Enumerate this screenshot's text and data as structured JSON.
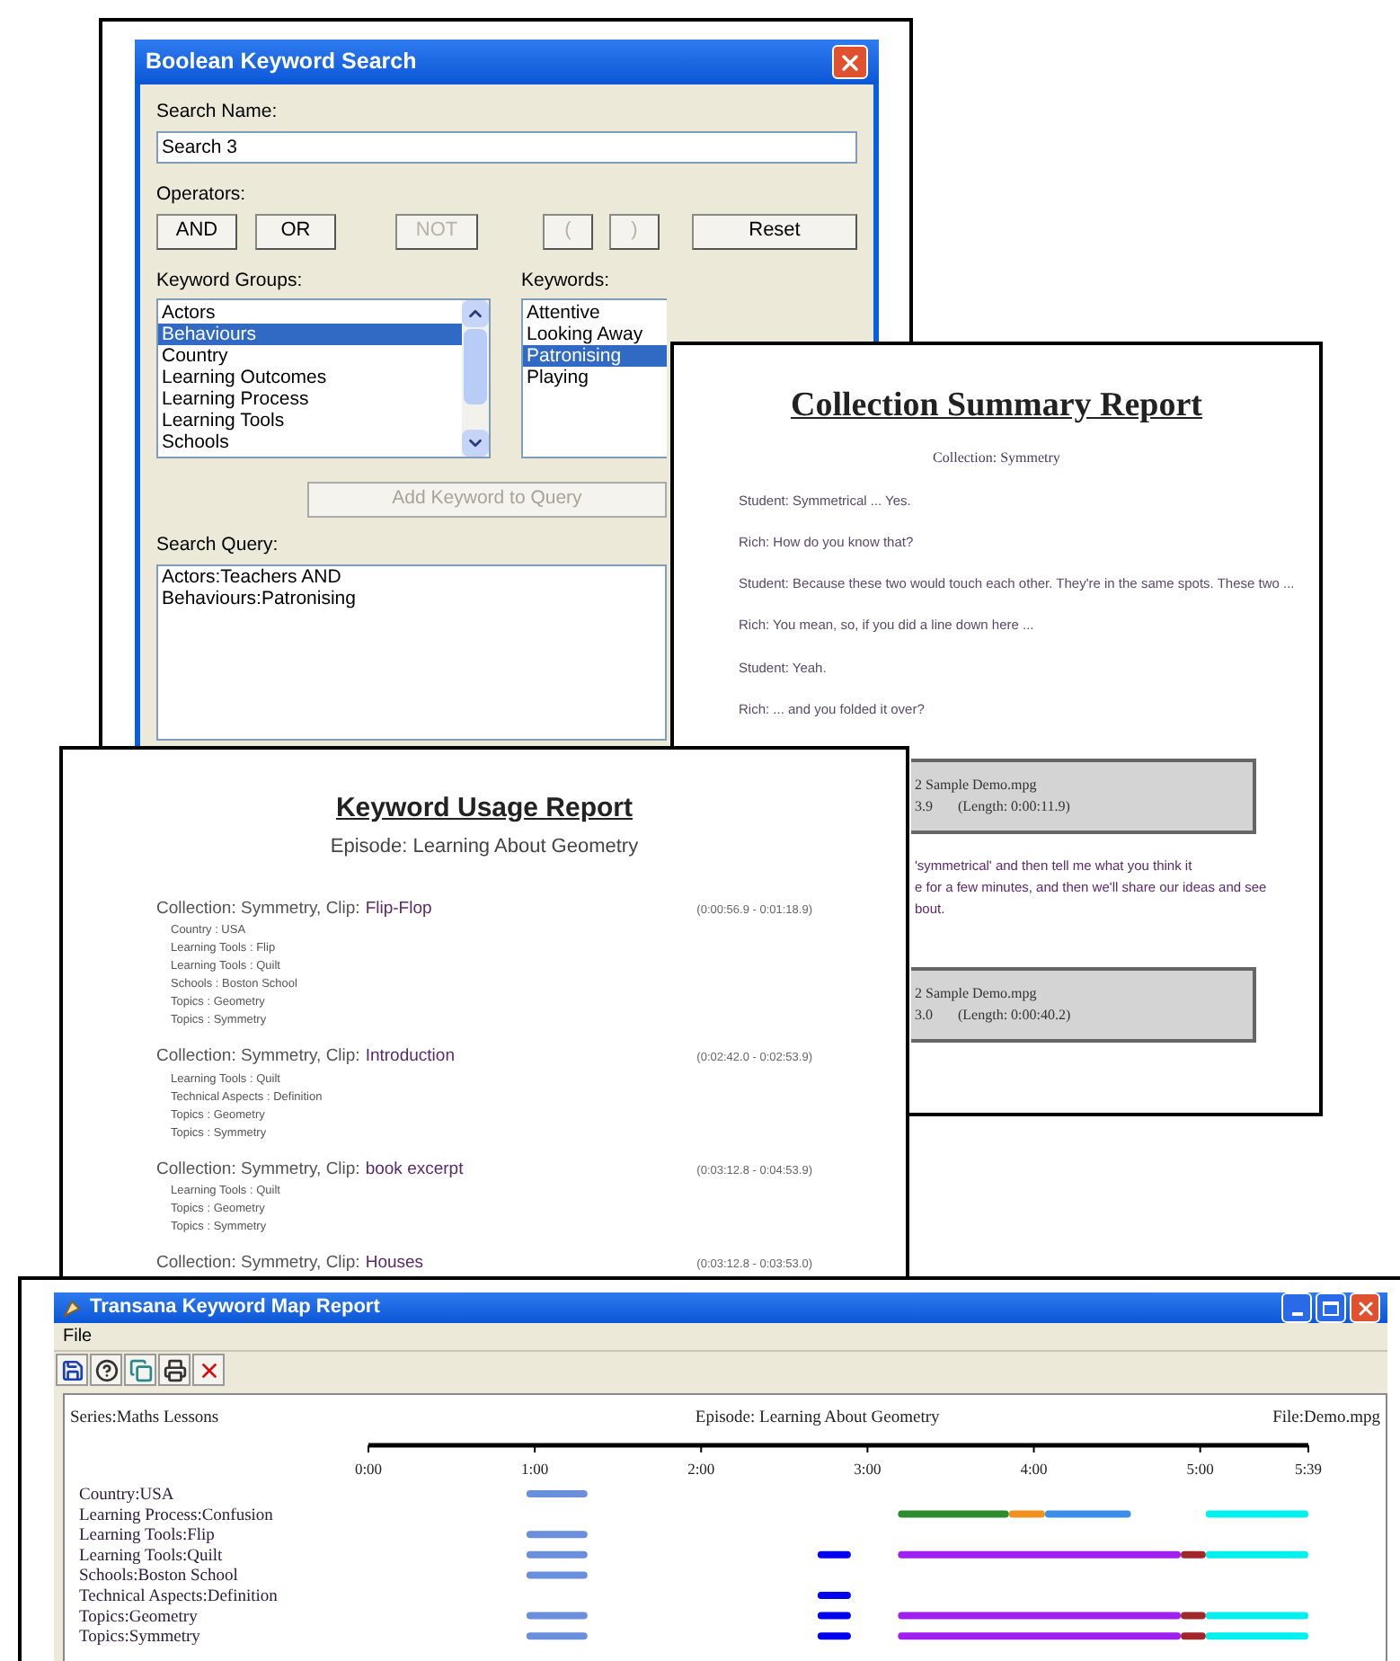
{
  "dialog": {
    "title": "Boolean Keyword Search",
    "search_name": {
      "label": "Search Name:",
      "value": "Search 3"
    },
    "operators": {
      "label": "Operators:",
      "buttons": [
        {
          "label": "AND",
          "disabled": false
        },
        {
          "label": "OR",
          "disabled": false
        },
        {
          "label": "NOT",
          "disabled": true
        },
        {
          "label": "(",
          "disabled": true
        },
        {
          "label": ")",
          "disabled": true
        },
        {
          "label": "Reset",
          "disabled": false
        }
      ]
    },
    "keyword_groups": {
      "label": "Keyword Groups:",
      "items": [
        {
          "label": "Actors",
          "selected": false
        },
        {
          "label": "Behaviours",
          "selected": true
        },
        {
          "label": "Country",
          "selected": false
        },
        {
          "label": "Learning Outcomes",
          "selected": false
        },
        {
          "label": "Learning Process",
          "selected": false
        },
        {
          "label": "Learning Tools",
          "selected": false
        },
        {
          "label": "Schools",
          "selected": false
        }
      ]
    },
    "keywords": {
      "label": "Keywords:",
      "items": [
        {
          "label": "Attentive",
          "selected": false
        },
        {
          "label": "Looking Away",
          "selected": false
        },
        {
          "label": "Patronising",
          "selected": true
        },
        {
          "label": "Playing",
          "selected": false
        }
      ]
    },
    "add_button": {
      "label": "Add Keyword to Query",
      "disabled": true
    },
    "search_query": {
      "label": "Search Query:",
      "value": "Actors:Teachers AND\nBehaviours:Patronising"
    }
  },
  "collection_report": {
    "title": "Collection Summary Report",
    "subtitle": "Collection: Symmetry",
    "lines": [
      "Student:  Symmetrical ... Yes.",
      "Rich:  How do you know that?",
      "Student:  Because these two would touch each other.  They're in the same spots.  These two ...",
      "Rich:  You mean, so, if you did a line down here ...",
      "Student:  Yeah.",
      "Rich:  ... and you folded it over?"
    ],
    "blocks": [
      {
        "kind": "clip",
        "name": "2 Sample Demo.mpg",
        "time": "3.9",
        "length": "(Length: 0:00:11.9)"
      },
      {
        "kind": "text",
        "lines": [
          "'symmetrical' and then tell me what you think it",
          "e for a few minutes, and then we'll share our ideas and see",
          "bout."
        ]
      },
      {
        "kind": "clip",
        "name": "2 Sample Demo.mpg",
        "time": "3.0",
        "length": "(Length: 0:00:40.2)"
      }
    ]
  },
  "usage_report": {
    "title": "Keyword Usage Report",
    "subtitle": "Episode: Learning About Geometry",
    "clips": [
      {
        "prefix": "Collection: Symmetry, Clip:",
        "name": "Flip-Flop",
        "time": "(0:00:56.9 - 0:01:18.9)",
        "keywords": [
          "Country : USA",
          "Learning Tools : Flip",
          "Learning Tools : Quilt",
          "Schools : Boston School",
          "Topics : Geometry",
          "Topics : Symmetry"
        ]
      },
      {
        "prefix": "Collection: Symmetry, Clip:",
        "name": "Introduction",
        "time": "(0:02:42.0 - 0:02:53.9)",
        "keywords": [
          "Learning Tools : Quilt",
          "Technical Aspects : Definition",
          "Topics : Geometry",
          "Topics : Symmetry"
        ]
      },
      {
        "prefix": "Collection: Symmetry, Clip:",
        "name": "book excerpt",
        "time": "(0:03:12.8 - 0:04:53.9)",
        "keywords": [
          "Learning Tools : Quilt",
          "Topics : Geometry",
          "Topics : Symmetry"
        ]
      },
      {
        "prefix": "Collection: Symmetry, Clip:",
        "name": "Houses",
        "time": "(0:03:12.8 - 0:03:53.0)"
      }
    ]
  },
  "keyword_map": {
    "title": "Transana Keyword Map Report",
    "menu": [
      "File"
    ],
    "series": "Series:Maths Lessons",
    "episode": "Episode: Learning About Geometry",
    "file": "File:Demo.mpg",
    "ticks": [
      "0:00",
      "1:00",
      "2:00",
      "3:00",
      "4:00",
      "5:00",
      "5:39"
    ],
    "rows": [
      {
        "label": "Country:USA",
        "segments": [
          {
            "color": "#6a8fdc"
          }
        ]
      },
      {
        "label": "Learning Process:Confusion",
        "segments": [
          {
            "color": "#2e8b2e"
          },
          {
            "color": "#f0901e"
          },
          {
            "color": "#3a8ee8"
          },
          {
            "color": "#00f0f0"
          }
        ]
      },
      {
        "label": "Learning Tools:Flip",
        "segments": [
          {
            "color": "#6a8fdc"
          }
        ]
      },
      {
        "label": "Learning Tools:Quilt",
        "segments": [
          {
            "color": "#6a8fdc"
          },
          {
            "color": "#0000ee"
          },
          {
            "color": "#a020f0"
          },
          {
            "color": "#a0282a"
          },
          {
            "color": "#00f0f0"
          }
        ]
      },
      {
        "label": "Schools:Boston School",
        "segments": [
          {
            "color": "#6a8fdc"
          }
        ]
      },
      {
        "label": "Technical Aspects:Definition",
        "segments": [
          {
            "color": "#0000ee"
          }
        ]
      },
      {
        "label": "Topics:Geometry",
        "segments": [
          {
            "color": "#6a8fdc"
          },
          {
            "color": "#0000ee"
          },
          {
            "color": "#a020f0"
          },
          {
            "color": "#a0282a"
          },
          {
            "color": "#00f0f0"
          }
        ]
      },
      {
        "label": "Topics:Symmetry",
        "segments": [
          {
            "color": "#6a8fdc"
          },
          {
            "color": "#0000ee"
          },
          {
            "color": "#a020f0"
          },
          {
            "color": "#a0282a"
          },
          {
            "color": "#00f0f0"
          }
        ]
      }
    ]
  }
}
